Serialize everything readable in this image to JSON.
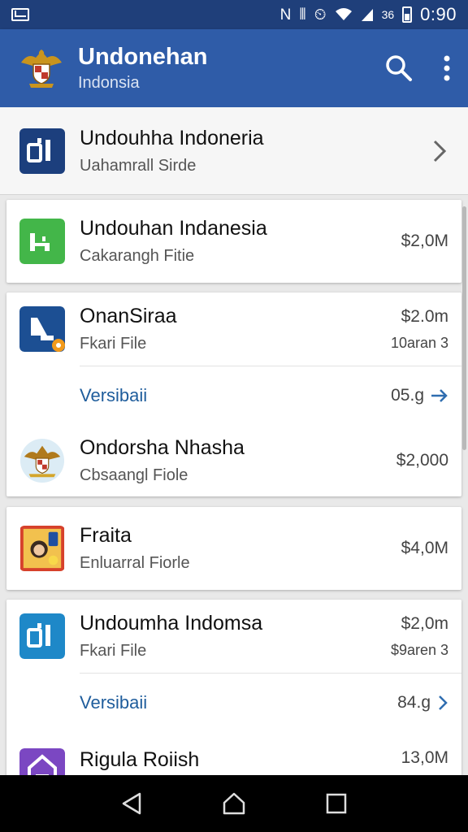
{
  "status_bar": {
    "time": "0:90",
    "battery_text": "36"
  },
  "app_bar": {
    "title": "Undonehan",
    "subtitle": "Indonsia"
  },
  "header_row": {
    "title": "Undouhha Indoneria",
    "subtitle": "Uahamrall Sirde"
  },
  "cards": [
    {
      "items": [
        {
          "title": "Undouhan Indanesia",
          "subtitle": "Cakarangh Fitie",
          "amount": "$2,0M"
        }
      ]
    },
    {
      "items": [
        {
          "title": "OnanSiraa",
          "subtitle": "Fkari File",
          "amount": "$2.0m",
          "meta": "10aran 3"
        },
        {
          "title": "Ondorsha Nhasha",
          "subtitle": "Cbsaangl Fiole",
          "amount": "$2,000"
        }
      ],
      "link": {
        "label": "Versibaii",
        "value": "05.g"
      }
    },
    {
      "items": [
        {
          "title": "Fraita",
          "subtitle": "Enluarral Fiorle",
          "amount": "$4,0M"
        }
      ]
    },
    {
      "items": [
        {
          "title": "Undoumha Indomsa",
          "subtitle": "Fkari File",
          "amount": "$2,0m",
          "meta": "$9aren 3"
        },
        {
          "title": "Rigula Roiish",
          "amount": "13,0M"
        }
      ],
      "link": {
        "label": "Versibaii",
        "value": "84.g"
      }
    }
  ],
  "colors": {
    "app_bar": "#2f5ca8",
    "status_bar": "#1f3f7a",
    "link": "#1f5d9c",
    "green": "#43b649",
    "navy": "#1c3f7d"
  },
  "icons": [
    "mail-icon",
    "nfc-icon",
    "vibrate-icon",
    "alarm-icon",
    "wifi-icon",
    "signal-icon",
    "battery-icon",
    "garuda-logo-icon",
    "search-icon",
    "more-vert-icon",
    "chevron-right-icon",
    "arrow-right-icon",
    "back-icon",
    "home-icon",
    "recents-icon"
  ]
}
